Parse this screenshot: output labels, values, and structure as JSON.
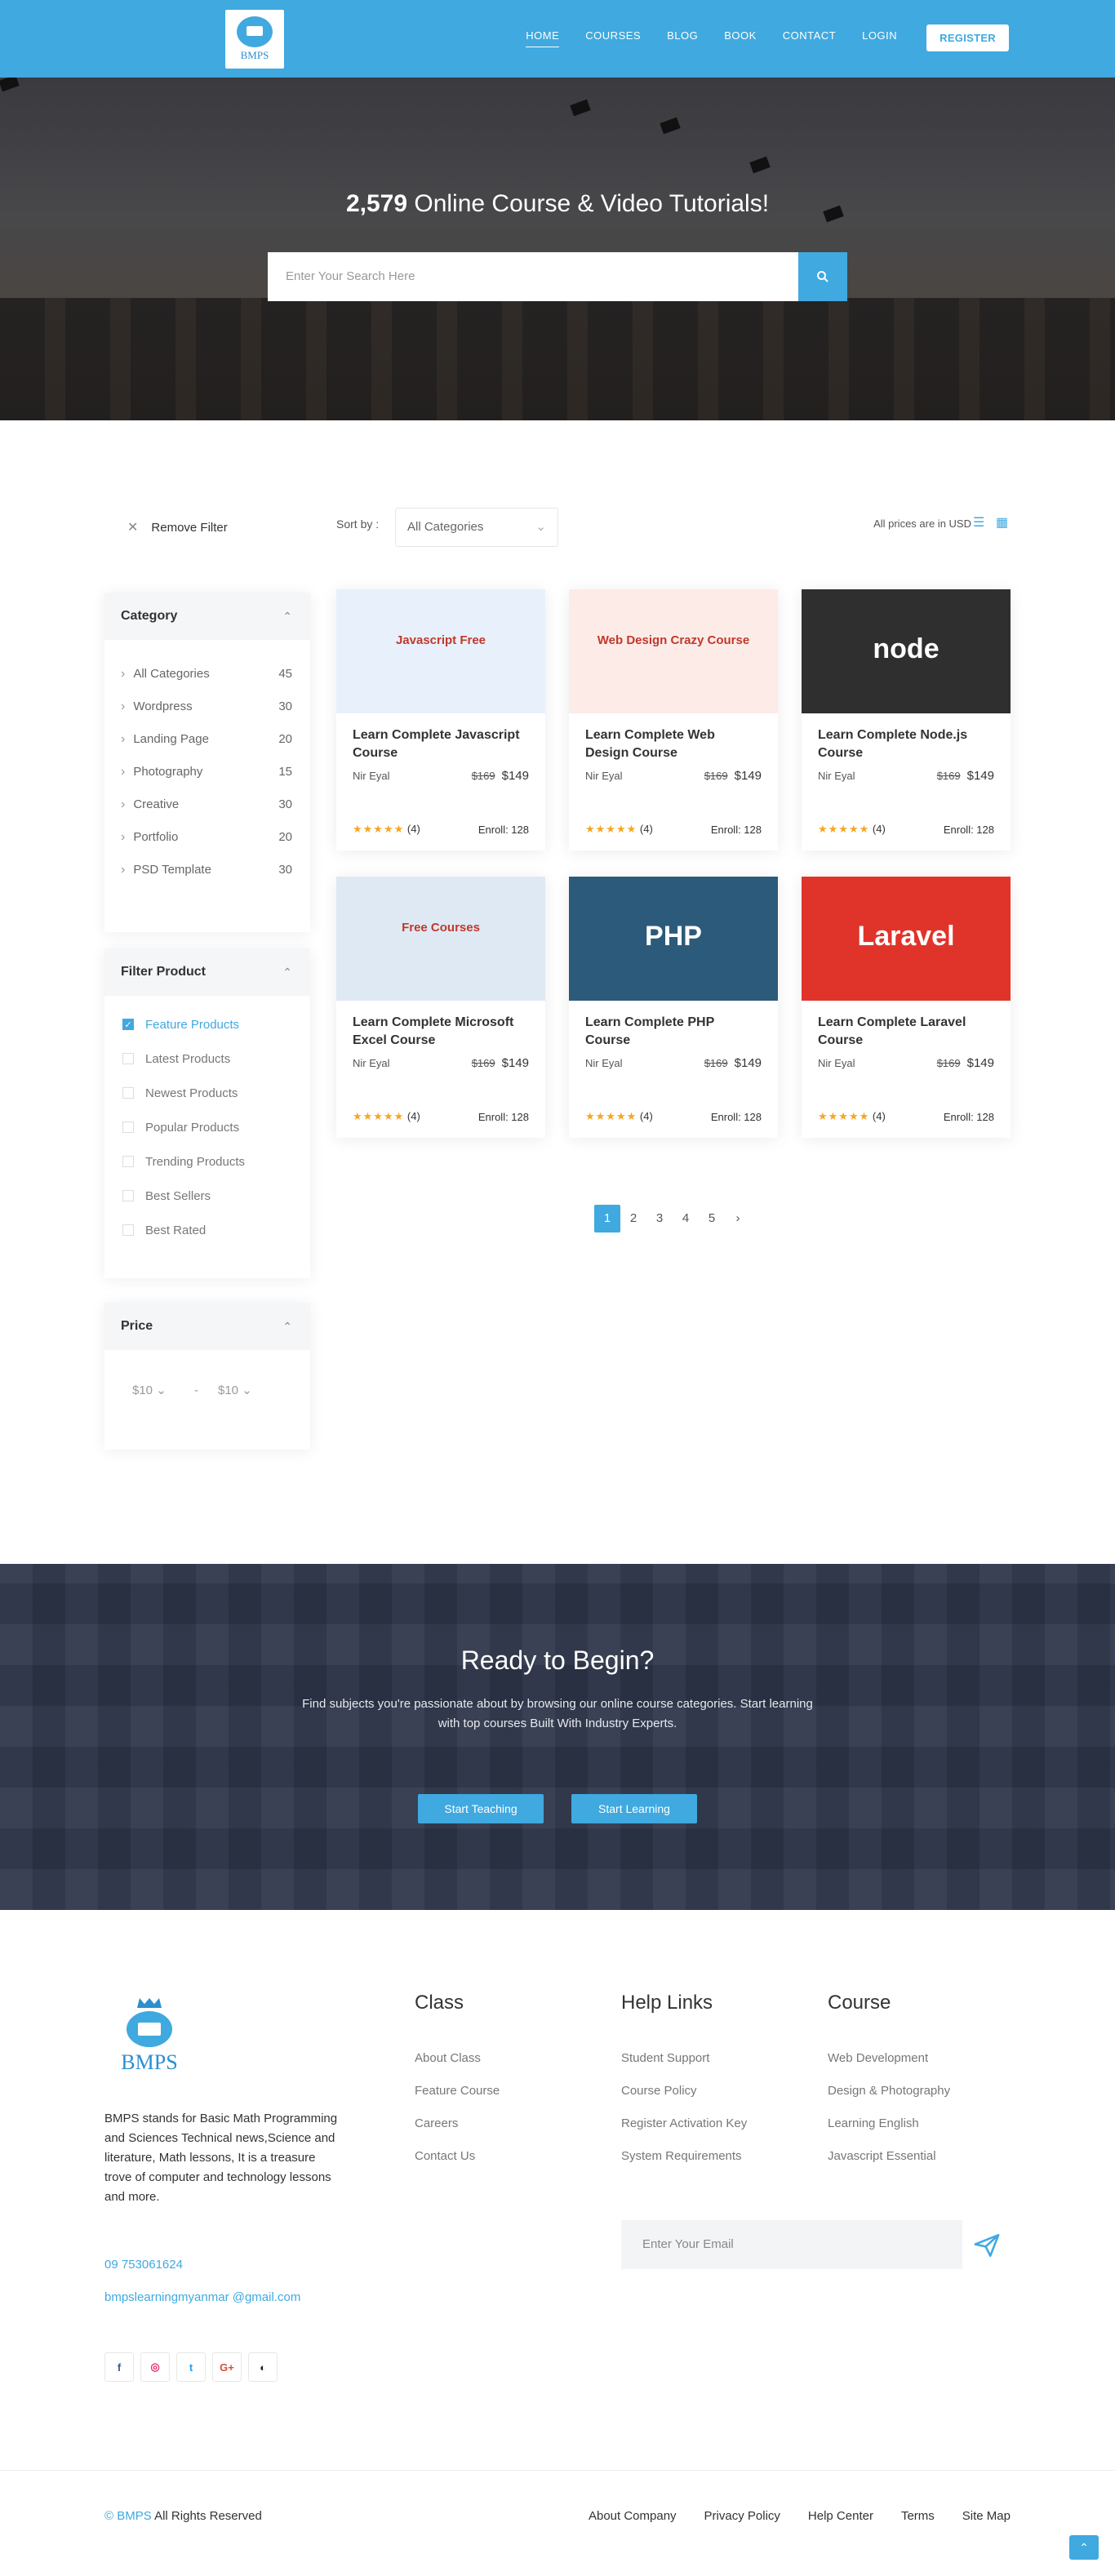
{
  "header": {
    "logo_text": "BMPS",
    "nav": [
      "HOME",
      "COURSES",
      "BLOG",
      "BOOK",
      "CONTACT",
      "LOGIN"
    ],
    "register_label": "REGISTER"
  },
  "hero": {
    "count": "2,579",
    "title_rest": "Online Course & Video Tutorials!",
    "search_placeholder": "Enter Your Search Here"
  },
  "filters": {
    "remove_filter": "Remove Filter",
    "sort_label": "Sort by :",
    "sort_value": "All Categories",
    "prices_note": "All prices are in USD"
  },
  "sidebar": {
    "category_title": "Category",
    "categories": [
      {
        "name": "All Categories",
        "count": "45"
      },
      {
        "name": "Wordpress",
        "count": "30"
      },
      {
        "name": "Landing Page",
        "count": "20"
      },
      {
        "name": "Photography",
        "count": "15"
      },
      {
        "name": "Creative",
        "count": "30"
      },
      {
        "name": "Portfolio",
        "count": "20"
      },
      {
        "name": "PSD Template",
        "count": "30"
      }
    ],
    "filter_title": "Filter Product",
    "filter_items": [
      {
        "label": "Feature Products",
        "checked": true
      },
      {
        "label": "Latest Products",
        "checked": false
      },
      {
        "label": "Newest Products",
        "checked": false
      },
      {
        "label": "Popular Products",
        "checked": false
      },
      {
        "label": "Trending Products",
        "checked": false
      },
      {
        "label": "Best Sellers",
        "checked": false
      },
      {
        "label": "Best Rated",
        "checked": false
      }
    ],
    "price_title": "Price",
    "price_min": "$10",
    "price_sep": "-",
    "price_max": "$10"
  },
  "courses": [
    {
      "title": "Learn Complete Javascript Course",
      "author": "Nir Eyal",
      "old_price": "$169",
      "price": "$149",
      "rating_count": "(4)",
      "enroll": "Enroll: 128",
      "image_text": "Javascript Free",
      "image_bg": "#e8f0fb"
    },
    {
      "title": "Learn Complete Web Design Course",
      "author": "Nir Eyal",
      "old_price": "$169",
      "price": "$149",
      "rating_count": "(4)",
      "enroll": "Enroll: 128",
      "image_text": "Web Design Crazy Course",
      "image_bg": "#fdebe8"
    },
    {
      "title": "Learn Complete Node.js Course",
      "author": "Nir Eyal",
      "old_price": "$169",
      "price": "$149",
      "rating_count": "(4)",
      "enroll": "Enroll: 128",
      "image_text": "node",
      "image_bg": "#2f2f2f"
    },
    {
      "title": "Learn Complete Microsoft Excel Course",
      "author": "Nir Eyal",
      "old_price": "$169",
      "price": "$149",
      "rating_count": "(4)",
      "enroll": "Enroll: 128",
      "image_text": "Free Courses",
      "image_bg": "#dfe9f3"
    },
    {
      "title": "Learn Complete PHP Course",
      "author": "Nir Eyal",
      "old_price": "$169",
      "price": "$149",
      "rating_count": "(4)",
      "enroll": "Enroll: 128",
      "image_text": "PHP",
      "image_bg": "#2c5a7a"
    },
    {
      "title": "Learn Complete Laravel Course",
      "author": "Nir Eyal",
      "old_price": "$169",
      "price": "$149",
      "rating_count": "(4)",
      "enroll": "Enroll: 128",
      "image_text": "Laravel",
      "image_bg": "#e0342b"
    }
  ],
  "pagination": [
    "1",
    "2",
    "3",
    "4",
    "5"
  ],
  "cta": {
    "title": "Ready to Begin?",
    "text": "Find subjects you're passionate about by browsing our online course categories. Start learning with top courses Built With Industry Experts.",
    "btn_teaching": "Start Teaching",
    "btn_learning": "Start Learning"
  },
  "footer": {
    "logo_name": "BMPS",
    "description": "BMPS stands for Basic Math Programming and Sciences Technical news,Science and literature, Math lessons, It is a treasure trove of computer and technology lessons and more.",
    "phone": "09 753061624",
    "email": "bmpslearningmyanmar @gmail.com",
    "social": [
      "f",
      "◎",
      "t",
      "G+",
      "◐"
    ],
    "class_title": "Class",
    "class_links": [
      "About Class",
      "Feature Course",
      "Careers",
      "Contact Us"
    ],
    "help_title": "Help Links",
    "help_links": [
      "Student Support",
      "Course Policy",
      "Register Activation Key",
      "System Requirements"
    ],
    "course_title": "Course",
    "course_links": [
      "Web Development",
      "Design & Photography",
      "Learning English",
      "Javascript Essential"
    ],
    "email_placeholder": "Enter Your Email",
    "copyright_symbol": "©",
    "copyright_brand": "BMPS",
    "copyright_text": "All Rights Reserved",
    "bottom_links": [
      "About Company",
      "Privacy Policy",
      "Help Center",
      "Terms",
      "Site Map"
    ]
  },
  "colors": {
    "accent": "#3fa9e0",
    "cta_bg": "#2d3549",
    "star": "#f5a623"
  }
}
